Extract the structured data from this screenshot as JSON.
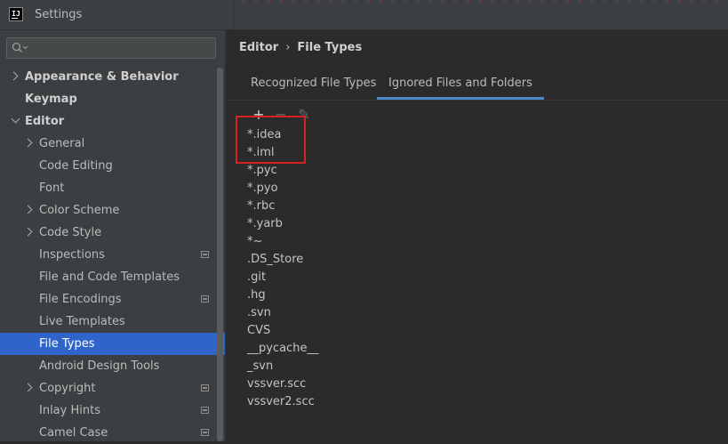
{
  "window": {
    "title": "Settings",
    "app_icon_text": "IJ"
  },
  "search": {
    "value": "",
    "placeholder": ""
  },
  "sidebar": {
    "items": [
      {
        "label": "Appearance & Behavior",
        "expander": "right"
      },
      {
        "label": "Keymap",
        "expander": ""
      },
      {
        "label": "Editor",
        "expander": "down"
      },
      {
        "label": "General",
        "expander": "right"
      },
      {
        "label": "Code Editing",
        "expander": ""
      },
      {
        "label": "Font",
        "expander": ""
      },
      {
        "label": "Color Scheme",
        "expander": "right"
      },
      {
        "label": "Code Style",
        "expander": "right"
      },
      {
        "label": "Inspections",
        "expander": "",
        "project_icon": true
      },
      {
        "label": "File and Code Templates",
        "expander": ""
      },
      {
        "label": "File Encodings",
        "expander": "",
        "project_icon": true
      },
      {
        "label": "Live Templates",
        "expander": ""
      },
      {
        "label": "File Types",
        "expander": "",
        "selected": true
      },
      {
        "label": "Android Design Tools",
        "expander": ""
      },
      {
        "label": "Copyright",
        "expander": "right",
        "project_icon": true
      },
      {
        "label": "Inlay Hints",
        "expander": "",
        "project_icon": true
      },
      {
        "label": "Camel Case",
        "expander": "",
        "project_icon": true
      }
    ]
  },
  "breadcrumb": {
    "parent": "Editor",
    "separator": "›",
    "current": "File Types"
  },
  "tabs": [
    {
      "label": "Recognized File Types",
      "active": false
    },
    {
      "label": "Ignored Files and Folders",
      "active": true
    }
  ],
  "toolbar": {
    "add": "+",
    "remove": "−",
    "edit": "✎"
  },
  "ignored_patterns": [
    "*.idea",
    "*.iml",
    "*.pyc",
    "*.pyo",
    "*.rbc",
    "*.yarb",
    "*~",
    ".DS_Store",
    ".git",
    ".hg",
    ".svn",
    "CVS",
    "__pycache__",
    "_svn",
    "vssver.scc",
    "vssver2.scc"
  ],
  "colors": {
    "selection": "#2f65ca",
    "tab_underline": "#4a88c7",
    "highlight_box": "#d62222"
  }
}
